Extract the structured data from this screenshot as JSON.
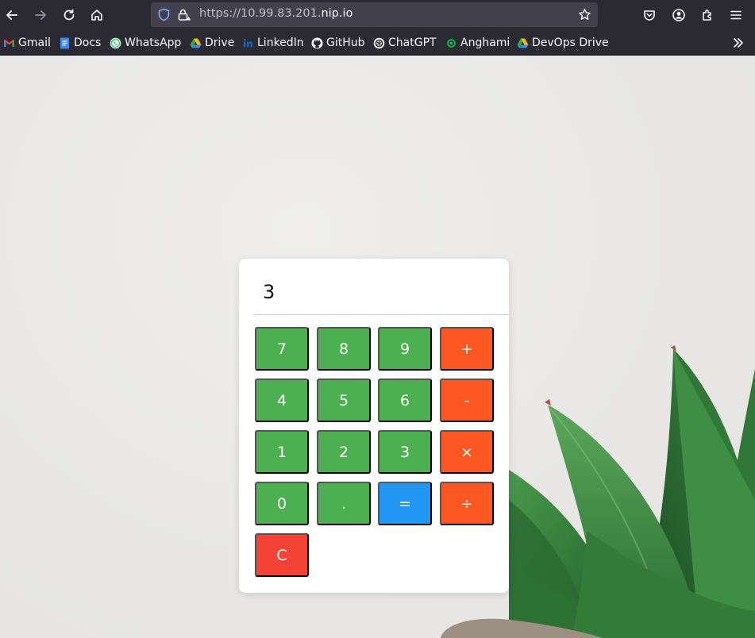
{
  "browser": {
    "url_scheme": "https://10.99.83.201.",
    "url_host": "nip.io",
    "bookmarks": [
      {
        "label": "Gmail",
        "icon": "gmail-icon"
      },
      {
        "label": "Docs",
        "icon": "docs-icon"
      },
      {
        "label": "WhatsApp",
        "icon": "whatsapp-icon"
      },
      {
        "label": "Drive",
        "icon": "drive-icon"
      },
      {
        "label": "LinkedIn",
        "icon": "linkedin-icon"
      },
      {
        "label": "GitHub",
        "icon": "github-icon"
      },
      {
        "label": "ChatGPT",
        "icon": "chatgpt-icon"
      },
      {
        "label": "Anghami",
        "icon": "anghami-icon"
      },
      {
        "label": "DevOps Drive",
        "icon": "drive-icon"
      }
    ]
  },
  "calculator": {
    "display_value": "3",
    "keys": {
      "seven": "7",
      "eight": "8",
      "nine": "9",
      "plus": "+",
      "four": "4",
      "five": "5",
      "six": "6",
      "minus": "-",
      "one": "1",
      "two": "2",
      "three": "3",
      "multiply": "×",
      "zero": "0",
      "dot": ".",
      "equals": "=",
      "divide": "÷",
      "clear": "C"
    }
  },
  "colors": {
    "number_key": "#4caf50",
    "operator_key": "#ff5722",
    "equals_key": "#2196f3",
    "clear_key": "#f44336"
  }
}
